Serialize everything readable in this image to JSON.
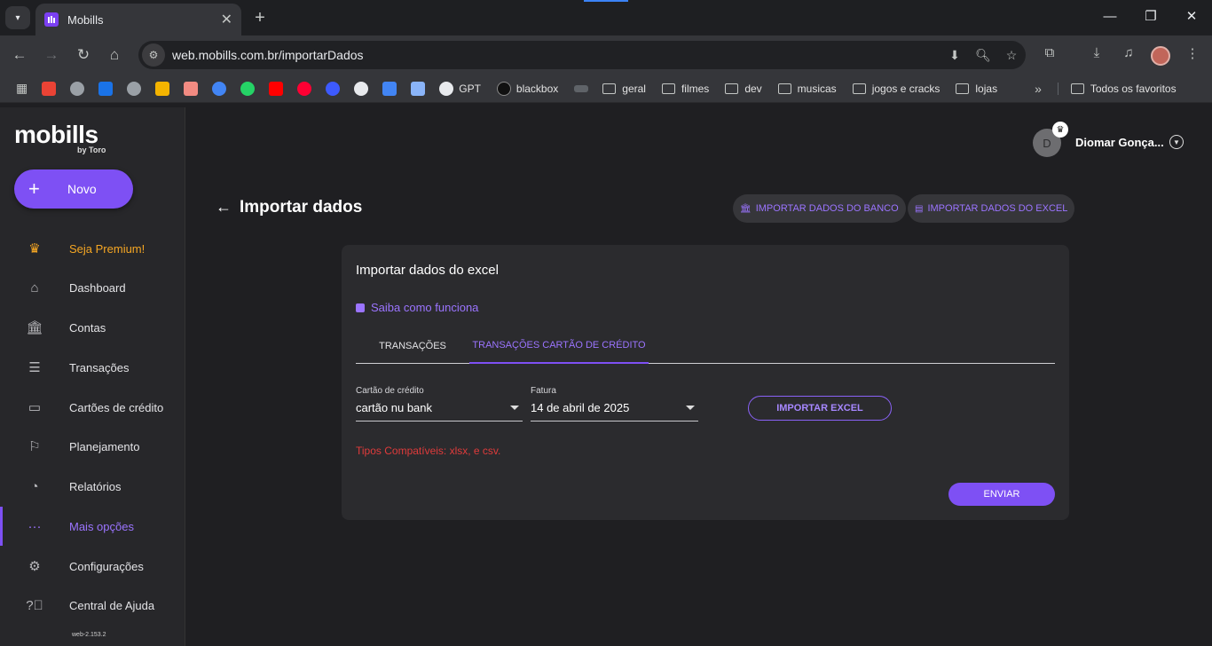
{
  "browser": {
    "tab_title": "Mobills",
    "url": "web.mobills.com.br/importarDados",
    "bookmarks": [
      {
        "label": "GPT"
      },
      {
        "label": "blackbox"
      },
      {
        "label": "geral"
      },
      {
        "label": "filmes"
      },
      {
        "label": "dev"
      },
      {
        "label": "musicas"
      },
      {
        "label": "jogos e cracks"
      },
      {
        "label": "lojas"
      }
    ],
    "all_bookmarks": "Todos os favoritos"
  },
  "sidebar": {
    "logo": "mobills",
    "logo_sub": "by Toro",
    "new_button": "Novo",
    "items": [
      {
        "label": "Seja Premium!",
        "icon": "crown-icon",
        "color": "#f5a623"
      },
      {
        "label": "Dashboard",
        "icon": "home-icon"
      },
      {
        "label": "Contas",
        "icon": "bank-icon"
      },
      {
        "label": "Transações",
        "icon": "list-icon"
      },
      {
        "label": "Cartões de crédito",
        "icon": "credit-card-icon"
      },
      {
        "label": "Planejamento",
        "icon": "flag-icon"
      },
      {
        "label": "Relatórios",
        "icon": "pie-chart-icon"
      },
      {
        "label": "Mais opções",
        "icon": "more-icon",
        "active": true
      },
      {
        "label": "Configurações",
        "icon": "gear-icon"
      },
      {
        "label": "Central de Ajuda",
        "icon": "help-icon"
      }
    ],
    "version": "web-2.153.2"
  },
  "header": {
    "avatar_letter": "D",
    "user_name": "Diomar Gonça..."
  },
  "page": {
    "title": "Importar dados",
    "bank_button": "IMPORTAR DADOS DO BANCO",
    "excel_button": "IMPORTAR DADOS DO EXCEL"
  },
  "card": {
    "title": "Importar dados do excel",
    "help_link": "Saiba como funciona",
    "tabs": [
      {
        "label": "TRANSAÇÕES",
        "selected": false
      },
      {
        "label": "TRANSAÇÕES CARTÃO DE CRÉDITO",
        "selected": true
      }
    ],
    "card_field": {
      "label": "Cartão de crédito",
      "value": "cartão nu bank"
    },
    "invoice_field": {
      "label": "Fatura",
      "value": "14 de abril de 2025"
    },
    "import_button": "IMPORTAR EXCEL",
    "compatible_types": "Tipos Compatíveis: xlsx, e csv.",
    "send_button": "ENVIAR"
  },
  "colors": {
    "accent": "#7e50f4",
    "error": "#e03b3b",
    "premium": "#f5a623"
  }
}
